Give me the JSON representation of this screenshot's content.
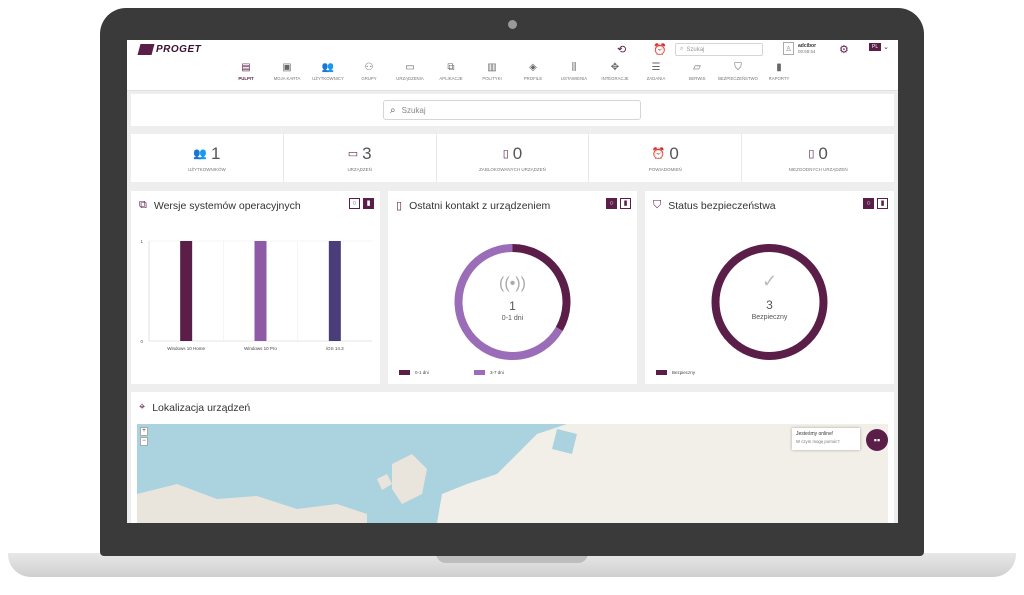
{
  "app": {
    "logo_text": "PROGET"
  },
  "topbar": {
    "search_placeholder": "Szukaj",
    "user_name": "adcibor",
    "user_time": "00:59:54",
    "language": "PL"
  },
  "nav": [
    {
      "label": "PULPIT",
      "icon": "dashboard-icon",
      "glyph": "▤",
      "active": true
    },
    {
      "label": "MOJA KARTA",
      "icon": "id-card-icon",
      "glyph": "▣"
    },
    {
      "label": "UŻYTKOWNICY",
      "icon": "users-icon",
      "glyph": "👥"
    },
    {
      "label": "GRUPY",
      "icon": "groups-icon",
      "glyph": "⚇"
    },
    {
      "label": "URZĄDZENIA",
      "icon": "devices-icon",
      "glyph": "▭"
    },
    {
      "label": "APLIKACJE",
      "icon": "apps-icon",
      "glyph": "⧉"
    },
    {
      "label": "POLITYKI",
      "icon": "policy-icon",
      "glyph": "▥"
    },
    {
      "label": "PROFILE",
      "icon": "tag-icon",
      "glyph": "◈"
    },
    {
      "label": "USTAWIENIA",
      "icon": "sliders-icon",
      "glyph": "⫼"
    },
    {
      "label": "INTEGRACJE",
      "icon": "puzzle-icon",
      "glyph": "✥"
    },
    {
      "label": "ZADANIA",
      "icon": "tasks-icon",
      "glyph": "☰"
    },
    {
      "label": "SERWIS",
      "icon": "laptop-icon",
      "glyph": "▱"
    },
    {
      "label": "BEZPIECZEŃSTWO",
      "icon": "shield-icon",
      "glyph": "⛉"
    },
    {
      "label": "RAPORTY",
      "icon": "reports-icon",
      "glyph": "▮"
    }
  ],
  "main_search": {
    "placeholder": "Szukaj"
  },
  "stats": [
    {
      "value": "1",
      "label": "UŻYTKOWNIKÓW",
      "icon": "users-icon",
      "glyph": "👥"
    },
    {
      "value": "3",
      "label": "URZĄDZEŃ",
      "icon": "devices-icon",
      "glyph": "▭"
    },
    {
      "value": "0",
      "label": "ZABLOKOWANYCH URZĄDZEŃ",
      "icon": "lock-device-icon",
      "glyph": "▯"
    },
    {
      "value": "0",
      "label": "POWIADOMIEŃ",
      "icon": "alarm-icon",
      "glyph": "⏰"
    },
    {
      "value": "0",
      "label": "NIEZGODNYCH URZĄDZEŃ",
      "icon": "noncompliant-device-icon",
      "glyph": "▯"
    }
  ],
  "cards": {
    "os": {
      "title": "Wersje systemów operacyjnych",
      "y_ticks": [
        "1",
        "0"
      ]
    },
    "contact": {
      "title": "Ostatni kontakt z urządzeniem",
      "center_value": "1",
      "center_label": "0-1 dni",
      "legend": [
        "0-1 dni",
        "3-7 dni"
      ]
    },
    "security": {
      "title": "Status bezpieczeństwa",
      "center_value": "3",
      "center_label": "Bezpieczny",
      "legend": [
        "Bezpieczny"
      ]
    }
  },
  "map": {
    "title": "Lokalizacja urządzeń",
    "chat_title": "Jesteśmy online!",
    "chat_subtitle": "W czym mogę pomóc?",
    "zoom_in": "+",
    "zoom_out": "−"
  },
  "colors": {
    "brand": "#5a1e49",
    "bar1": "#5a1e49",
    "bar2": "#8f5aa5",
    "bar3": "#4b3d7a",
    "donut_light": "#9b6db8"
  },
  "chart_data": [
    {
      "type": "bar",
      "categories": [
        "Windows 10 Home",
        "Windows 10 Pro",
        "iOS 14.3"
      ],
      "values": [
        1,
        1,
        1
      ],
      "ylim": [
        0,
        1
      ]
    },
    {
      "type": "pie",
      "categories": [
        "0-1 dni",
        "3-7 dni"
      ],
      "values": [
        1,
        2
      ]
    },
    {
      "type": "pie",
      "categories": [
        "Bezpieczny"
      ],
      "values": [
        3
      ]
    }
  ]
}
